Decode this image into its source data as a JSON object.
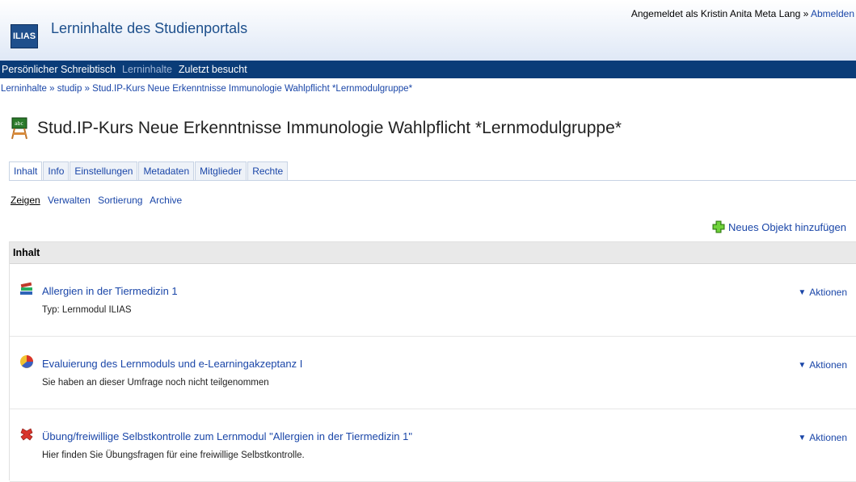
{
  "header": {
    "logo": "ILIAS",
    "site_title": "Lerninhalte des Studienportals",
    "user_prefix": "Angemeldet als Kristin Anita Meta Lang » ",
    "logout_label": "Abmelden"
  },
  "mainnav": {
    "items": [
      {
        "label": "Persönlicher Schreibtisch",
        "active": true
      },
      {
        "label": "Lerninhalte",
        "active": false
      },
      {
        "label": "Zuletzt besucht",
        "active": true
      }
    ]
  },
  "breadcrumb": "Lerninhalte » studip » Stud.IP-Kurs Neue Erkenntnisse Immunologie Wahlpflicht *Lernmodulgruppe*",
  "page_title": "Stud.IP-Kurs Neue Erkenntnisse Immunologie Wahlpflicht *Lernmodulgruppe*",
  "tabs": [
    "Inhalt",
    "Info",
    "Einstellungen",
    "Metadaten",
    "Mitglieder",
    "Rechte"
  ],
  "subtabs": [
    "Zeigen",
    "Verwalten",
    "Sortierung",
    "Archive"
  ],
  "add_object_label": "Neues Objekt hinzufügen",
  "content": {
    "header": "Inhalt",
    "items": [
      {
        "title": "Allergien in der Tiermedizin 1",
        "desc": "Typ: Lernmodul ILIAS",
        "actions": "Aktionen",
        "icon": "learning-module-icon"
      },
      {
        "title": "Evaluierung des Lernmoduls und e-Learningakzeptanz I",
        "desc": "Sie haben an dieser Umfrage noch nicht teilgenommen",
        "actions": "Aktionen",
        "icon": "survey-icon"
      },
      {
        "title": "Übung/freiwillige Selbstkontrolle zum Lernmodul \"Allergien in der Tiermedizin 1\"",
        "desc": "Hier finden Sie Übungsfragen für eine freiwillige Selbstkontrolle.",
        "actions": "Aktionen",
        "icon": "test-icon"
      }
    ]
  },
  "colors": {
    "nav_bg": "#0a3c78",
    "link": "#1a46a8"
  }
}
